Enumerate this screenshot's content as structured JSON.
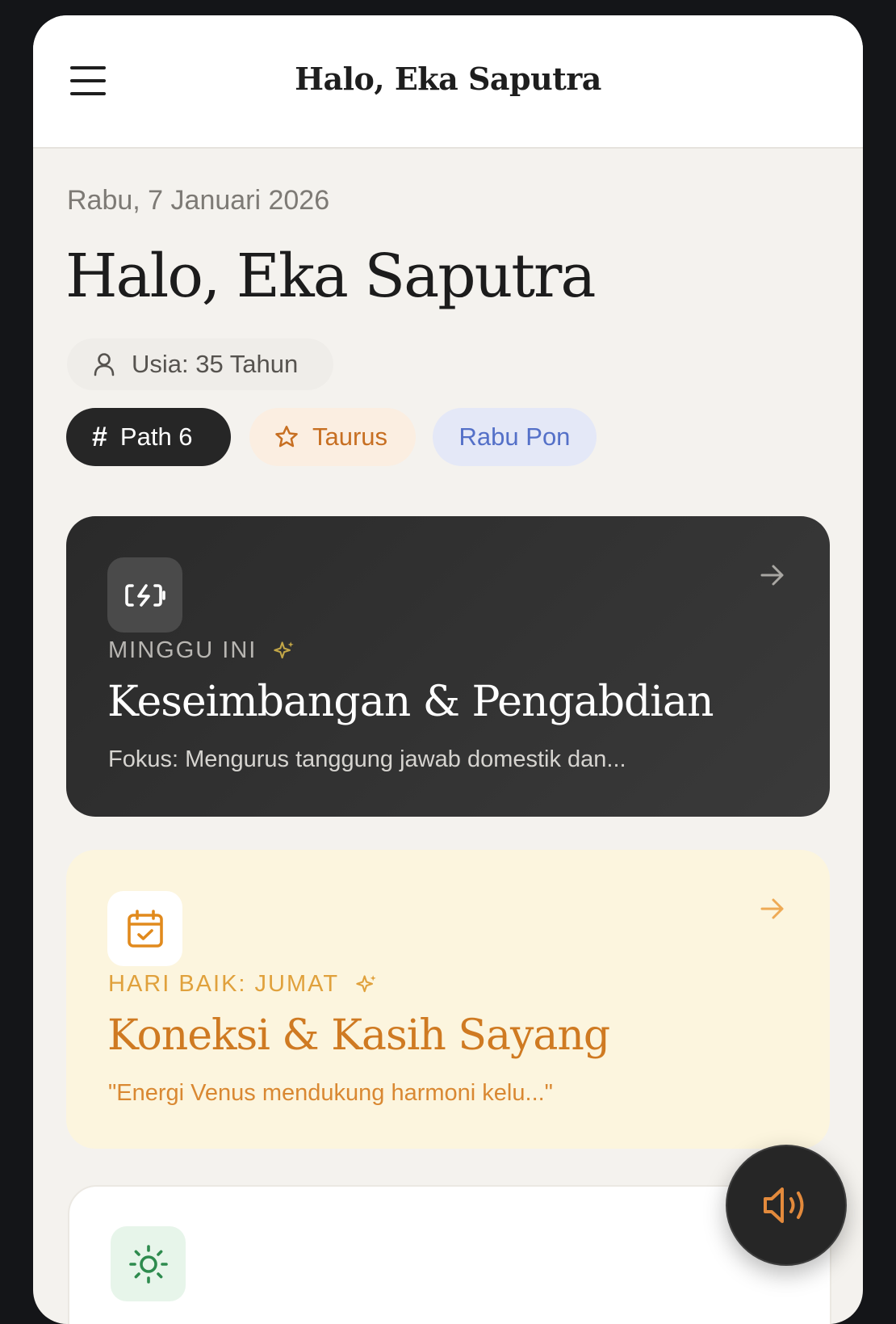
{
  "header": {
    "title": "Halo, Eka Saputra",
    "menu_icon": "hamburger-icon"
  },
  "main": {
    "date": "Rabu, 7 Januari 2026",
    "greeting": "Halo, Eka Saputra",
    "age_label": "Usia: 35 Tahun",
    "tags": {
      "path": "Path 6",
      "zodiac": "Taurus",
      "weton": "Rabu Pon"
    }
  },
  "cards": {
    "week": {
      "label": "MINGGU INI",
      "title": "Keseimbangan & Pengabdian",
      "subtitle": "Fokus: Mengurus tanggung jawab domestik dan..."
    },
    "day": {
      "label": "HARI BAIK: JUMAT",
      "title": "Koneksi & Kasih Sayang",
      "subtitle": "\"Energi Venus mendukung harmoni kelu...\""
    }
  },
  "colors": {
    "accent_orange": "#cf7a22",
    "dark": "#262626",
    "weton_blue": "#5470c8",
    "green": "#2e8b4e"
  },
  "icons": {
    "week": "battery-charging-icon",
    "day": "calendar-check-icon",
    "third": "sun-icon",
    "fab": "volume-icon"
  }
}
